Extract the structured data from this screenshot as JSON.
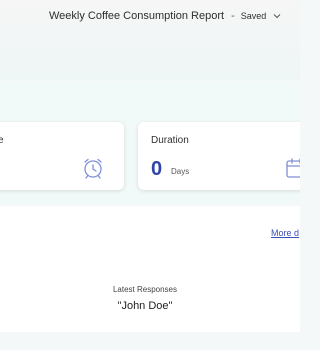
{
  "header": {
    "title": "Weekly Coffee Consumption Report",
    "separator": "-",
    "status": "Saved"
  },
  "summary": {
    "left_card": {
      "label_fragment": "e",
      "icon": "alarm-clock-icon"
    },
    "right_card": {
      "label": "Duration",
      "value": "0",
      "unit": "Days",
      "icon": "calendar-icon"
    }
  },
  "main": {
    "more_link": "More d",
    "latest_label": "Latest Responses",
    "latest_name": "\"John Doe\""
  },
  "colors": {
    "accent": "#2f44a8",
    "link": "#3b4fb8",
    "icon": "#7f8fd6"
  }
}
